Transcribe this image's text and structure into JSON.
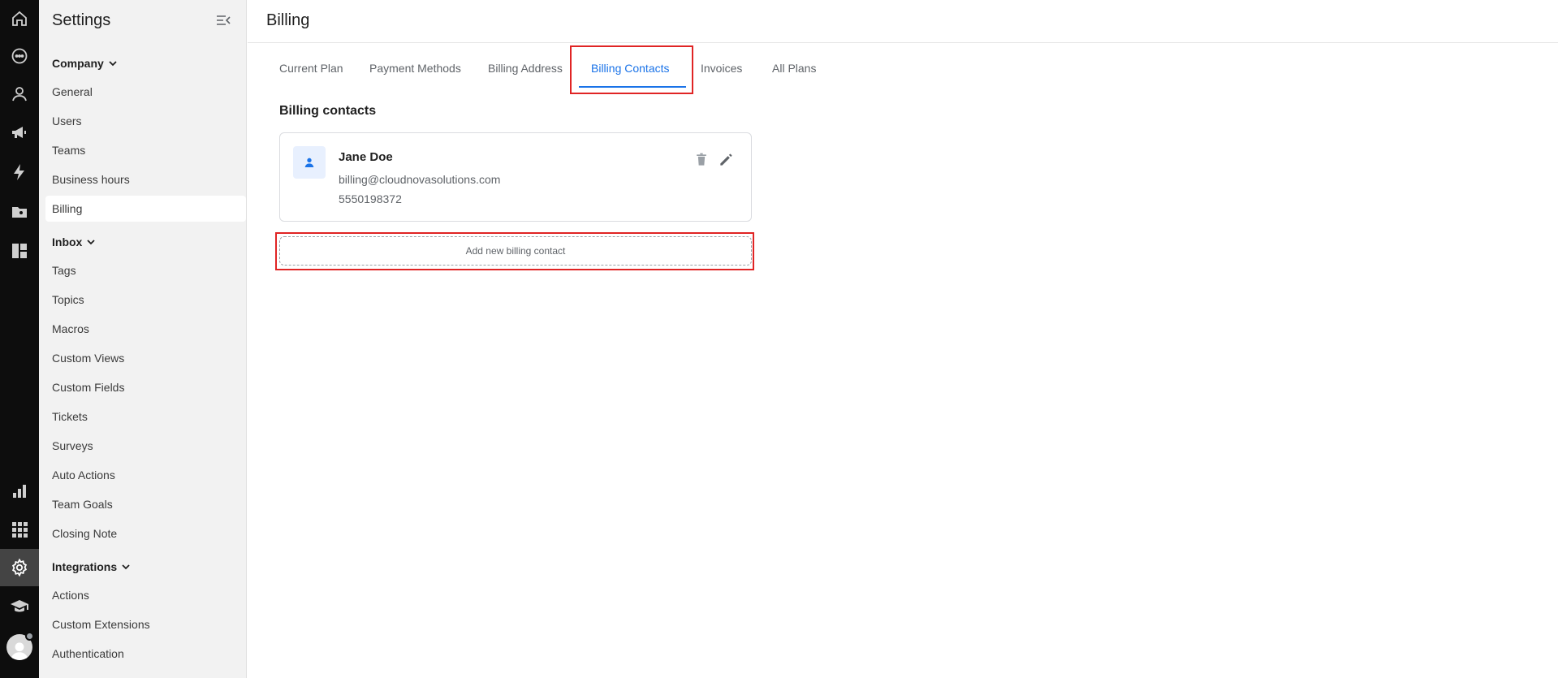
{
  "sidebar": {
    "title": "Settings",
    "sections": {
      "company": {
        "label": "Company",
        "items": [
          "General",
          "Users",
          "Teams",
          "Business hours",
          "Billing"
        ]
      },
      "inbox": {
        "label": "Inbox",
        "items": [
          "Tags",
          "Topics",
          "Macros",
          "Custom Views",
          "Custom Fields",
          "Tickets",
          "Surveys",
          "Auto Actions",
          "Team Goals",
          "Closing Note"
        ]
      },
      "integrations": {
        "label": "Integrations",
        "items": [
          "Actions",
          "Custom Extensions",
          "Authentication"
        ]
      }
    },
    "active_item": "Billing"
  },
  "rail": {
    "icons": [
      "home-icon",
      "chat-icon",
      "contacts-icon",
      "megaphone-icon",
      "bolt-icon",
      "folder-contact-icon",
      "dashboard-icon",
      "reports-icon",
      "apps-grid-icon",
      "settings-icon",
      "learn-icon",
      "avatar-icon"
    ],
    "active": "settings-icon"
  },
  "header": {
    "title": "Billing"
  },
  "tabs": [
    "Current Plan",
    "Payment Methods",
    "Billing Address",
    "Billing Contacts",
    "Invoices",
    "All Plans"
  ],
  "active_tab": "Billing Contacts",
  "billing_contacts": {
    "section_title": "Billing contacts",
    "contacts": [
      {
        "name": "Jane Doe",
        "email": "billing@cloudnovasolutions.com",
        "phone": "5550198372"
      }
    ],
    "add_label": "Add new billing contact"
  },
  "colors": {
    "accent": "#1a73e8",
    "highlight": "#e02424",
    "rail_bg": "#0d0d0d",
    "sidebar_bg": "#f2f2f2"
  }
}
